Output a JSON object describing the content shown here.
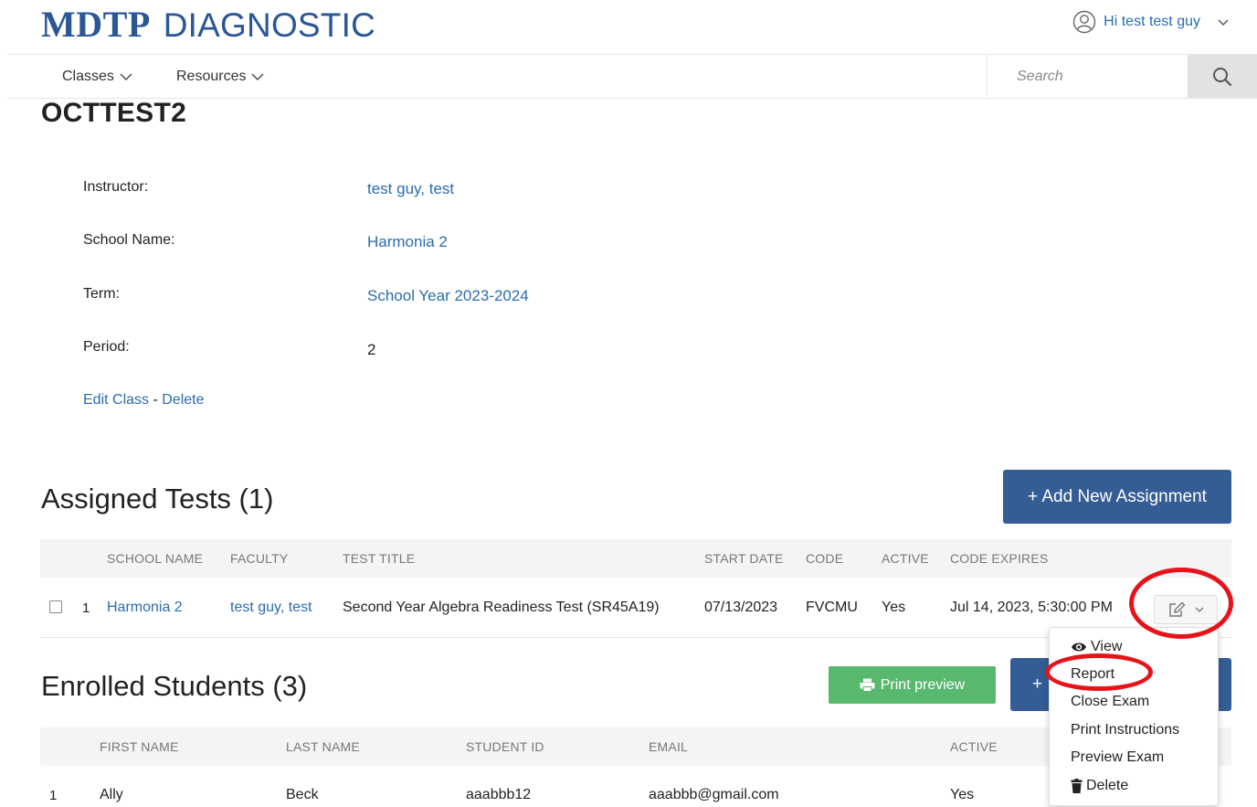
{
  "header": {
    "brand_bold": "MDTP",
    "brand_light": "DIAGNOSTIC",
    "user_greeting": "Hi test test guy"
  },
  "nav": {
    "classes": "Classes",
    "resources": "Resources",
    "search_placeholder": "Search"
  },
  "class_info": {
    "title": "OCTTEST2",
    "instructor_label": "Instructor:",
    "instructor_value": "test guy, test",
    "school_label": "School Name:",
    "school_value": "Harmonia 2",
    "term_label": "Term:",
    "term_value": "School Year 2023-2024",
    "period_label": "Period:",
    "period_value": "2",
    "edit_link": "Edit Class",
    "separator": " - ",
    "delete_link": "Delete"
  },
  "assigned": {
    "title": "Assigned Tests (1)",
    "add_button": "+  Add New Assignment",
    "columns": {
      "school_name": "SCHOOL NAME",
      "faculty": "FACULTY",
      "test_title": "TEST TITLE",
      "start_date": "START DATE",
      "code": "CODE",
      "active": "ACTIVE",
      "code_expires": "CODE EXPIRES"
    },
    "rows": [
      {
        "index": "1",
        "school_name": "Harmonia 2",
        "faculty": "test guy, test",
        "test_title": "Second Year Algebra Readiness Test (SR45A19)",
        "start_date": "07/13/2023",
        "code": "FVCMU",
        "active": "Yes",
        "code_expires": "Jul 14, 2023, 5:30:00 PM"
      }
    ]
  },
  "actions_menu": {
    "items": [
      "View",
      "Report",
      "Close Exam",
      "Print Instructions",
      "Preview Exam",
      "Delete"
    ]
  },
  "enrolled": {
    "title": "Enrolled Students (3)",
    "print_button": "Print preview",
    "add_button_glyph": "+",
    "columns": {
      "first_name": "FIRST NAME",
      "last_name": "LAST NAME",
      "student_id": "STUDENT ID",
      "email": "EMAIL",
      "active": "ACTIVE"
    },
    "rows": [
      {
        "index": "1",
        "first_name": "Ally",
        "last_name": "Beck",
        "student_id": "aaabbb12",
        "email": "aaabbb@gmail.com",
        "active": "Yes"
      }
    ]
  },
  "colors": {
    "brand_blue": "#2b5797",
    "link_blue": "#2b6cb0",
    "primary_button": "#345d96",
    "print_button": "#58b86d",
    "annotation_red": "#e8121a"
  },
  "icons": [
    "user-circle-icon",
    "chevron-down-icon",
    "search-icon",
    "edit-icon",
    "eye-icon",
    "printer-icon",
    "trash-icon"
  ]
}
